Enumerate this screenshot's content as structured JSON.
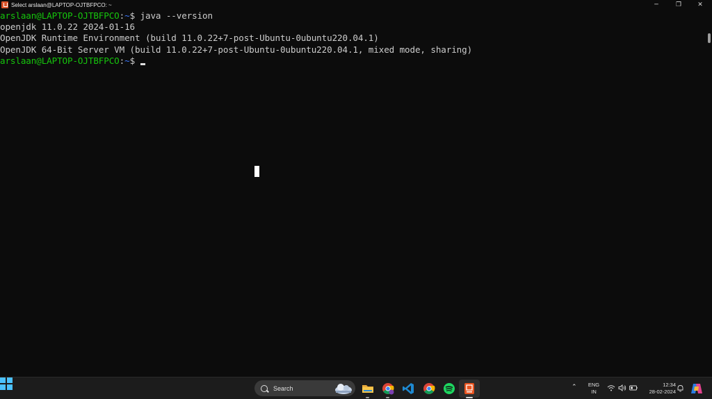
{
  "window": {
    "title": "Select arslaan@LAPTOP-OJTBFPCO: ~",
    "controls": {
      "minimize": "─",
      "maximize": "❐",
      "close": "✕"
    }
  },
  "terminal": {
    "prompt_user": "arslaan@LAPTOP-OJTBFPCO",
    "prompt_sep": ":",
    "prompt_path": "~",
    "prompt_dollar": "$ ",
    "command": "java --version",
    "output": [
      "openjdk 11.0.22 2024-01-16",
      "OpenJDK Runtime Environment (build 11.0.22+7-post-Ubuntu-0ubuntu220.04.1)",
      "OpenJDK 64-Bit Server VM (build 11.0.22+7-post-Ubuntu-0ubuntu220.04.1, mixed mode, sharing)"
    ]
  },
  "taskbar": {
    "search_label": "Search",
    "apps": [
      "explorer-icon",
      "chrome-icon",
      "vscode-icon",
      "chrome-icon",
      "spotify-icon",
      "ubuntu-icon"
    ],
    "tray": {
      "lang_line1": "ENG",
      "lang_line2": "IN",
      "time": "12:34",
      "date": "28-02-2024",
      "chevron": "⌃"
    }
  },
  "colors": {
    "prompt_user": "#16c60c",
    "prompt_path": "#3b78ff",
    "text": "#cccccc",
    "background": "#0c0c0c",
    "taskbar": "#1c1c1c"
  }
}
